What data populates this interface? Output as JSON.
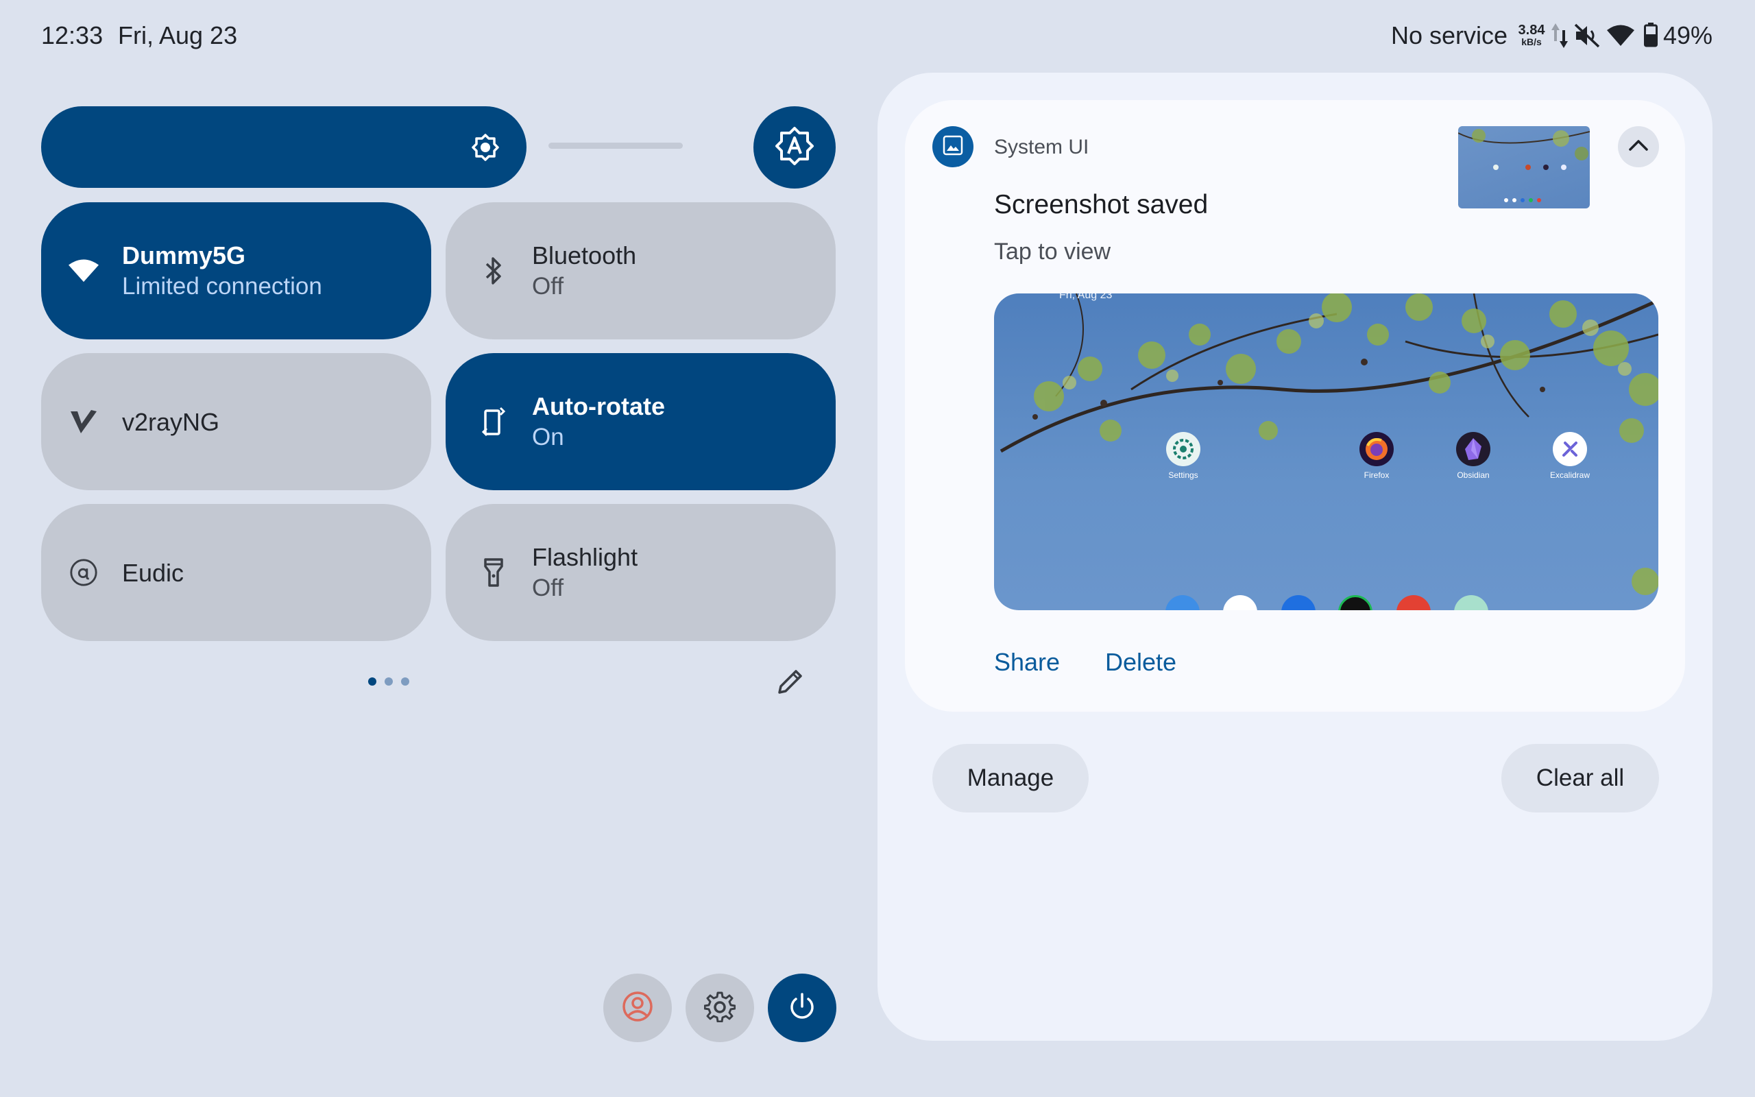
{
  "status_bar": {
    "time": "12:33",
    "date": "Fri, Aug 23",
    "network": "No service",
    "speed_value": "3.84",
    "speed_unit": "kB/s",
    "battery": "49%",
    "icons": [
      "data-arrows-icon",
      "mute-icon",
      "wifi-icon",
      "battery-icon"
    ]
  },
  "brightness": {
    "level": 0.72,
    "icon": "brightness-icon",
    "auto_icon": "auto-brightness-icon"
  },
  "tiles": [
    {
      "title": "Dummy5G",
      "subtitle": "Limited connection",
      "state": "on",
      "icon": "wifi-icon"
    },
    {
      "title": "Bluetooth",
      "subtitle": "Off",
      "state": "off",
      "icon": "bluetooth-icon"
    },
    {
      "title": "v2rayNG",
      "subtitle": "",
      "state": "off",
      "icon": "v2ray-icon"
    },
    {
      "title": "Auto-rotate",
      "subtitle": "On",
      "state": "on",
      "icon": "rotate-icon"
    },
    {
      "title": "Eudic",
      "subtitle": "",
      "state": "off",
      "icon": "eudic-icon"
    },
    {
      "title": "Flashlight",
      "subtitle": "Off",
      "state": "off",
      "icon": "flashlight-icon"
    }
  ],
  "pager": {
    "pages": 3,
    "current": 1
  },
  "bottom_buttons": [
    "user-icon",
    "settings-icon",
    "power-icon"
  ],
  "notification": {
    "app": "System UI",
    "title": "Screenshot saved",
    "text": "Tap to view",
    "actions": [
      "Share",
      "Delete"
    ],
    "preview": {
      "date_fragment": "Fri, Aug 23",
      "apps": [
        "Settings",
        "Firefox",
        "Obsidian",
        "Excalidraw"
      ]
    }
  },
  "footer": {
    "manage": "Manage",
    "clear_all": "Clear all"
  },
  "colors": {
    "background": "#dce2ee",
    "accent": "#01467f",
    "tile_off": "#c3c8d2",
    "panel": "#eef2fb",
    "link": "#0a5b9c"
  }
}
